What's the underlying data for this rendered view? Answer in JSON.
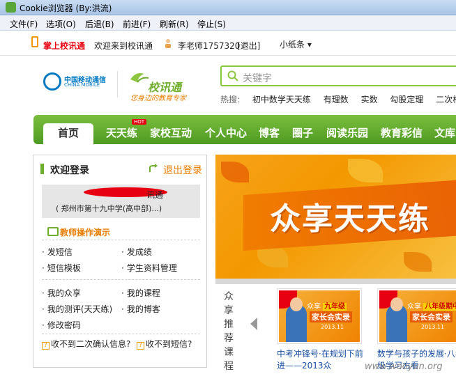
{
  "window": {
    "title": "Cookie浏览器 (By:洪流)"
  },
  "menu": [
    "文件(F)",
    "选项(O)",
    "后退(B)",
    "前进(F)",
    "刷新(R)",
    "停止(S)"
  ],
  "topbar": {
    "brand": "掌上校讯通",
    "welcome": "欢迎来到校讯通",
    "user": "李老师1757320",
    "logout": "[退出]",
    "note": "小纸条 ▾"
  },
  "logos": {
    "cm_cn": "中国移动通信",
    "cm_en": "CHINA MOBILE",
    "xxt_name": "校讯通",
    "xxt_slogan": "您身边的教育专家"
  },
  "search": {
    "placeholder": "关键字",
    "hot_label": "热搜:",
    "hot_terms": [
      "初中数学天天练",
      "有理数",
      "实数",
      "勾股定理",
      "二次根"
    ]
  },
  "nav": {
    "home": "首页",
    "hot_badge": "HOT",
    "items": [
      "天天练",
      "家校互动",
      "个人中心",
      "博客",
      "圈子",
      "阅读乐园",
      "教育彩信",
      "文库"
    ]
  },
  "login": {
    "title": "欢迎登录",
    "exit": "退出登录",
    "username": "讯通",
    "school": "( 郑州市第十九中学(高中部)...)",
    "demo": "教师操作演示",
    "links_a": [
      "发短信",
      "发成绩",
      "短信模板",
      "学生资料管理"
    ],
    "links_b": [
      "我的众享",
      "我的课程",
      "我的测评(天天练)",
      "我的博客",
      "修改密码"
    ],
    "q1": "收不到二次确认信息?",
    "q2": "收不到短信?"
  },
  "banner": {
    "text": "众享天天练"
  },
  "recommend": {
    "title": "众享推荐课程",
    "cards": [
      {
        "top": "众享",
        "grade": "九年级",
        "sub": "家长会实录",
        "date": "2013.11",
        "caption": "中考冲锋号·在规划下前进——2013众"
      },
      {
        "top": "众享",
        "grade": "八年级期中",
        "sub": "家长会实录",
        "date": "2013.11",
        "caption": "数学与孩子的发展·八年级学习方看"
      }
    ]
  },
  "watermark": "www.wooyun.org"
}
